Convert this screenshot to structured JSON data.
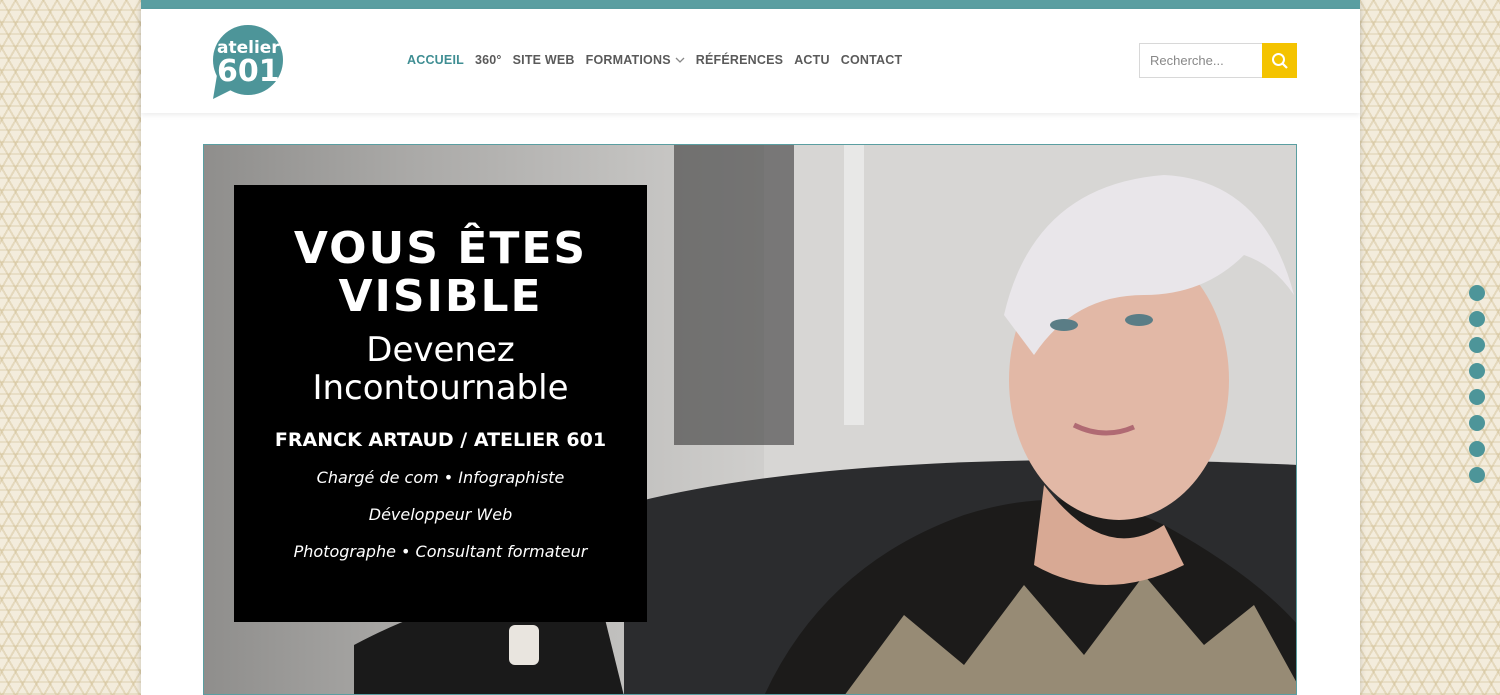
{
  "brand": {
    "logo_text_top": "atelier",
    "logo_text_bottom": "601",
    "accent": "#5a9ea1",
    "search_button": "#f4c300"
  },
  "nav": {
    "items": [
      {
        "label": "ACCUEIL",
        "active": true
      },
      {
        "label": "360°"
      },
      {
        "label": "SITE WEB"
      },
      {
        "label": "FORMATIONS",
        "icon": "chevron-down-icon"
      },
      {
        "label": "RÉFÉRENCES"
      },
      {
        "label": "ACTU"
      },
      {
        "label": "CONTACT"
      }
    ]
  },
  "search": {
    "placeholder": "Recherche...",
    "icon": "search-icon"
  },
  "hero": {
    "headline": "VOUS ÊTES VISIBLE",
    "subheadline": "Devenez Incontournable",
    "name": "FRANCK ARTAUD / ATELIER 601",
    "roles": [
      "Chargé de com • Infographiste",
      "Développeur  Web",
      "Photographe • Consultant formateur"
    ]
  },
  "slider": {
    "dot_count": 8
  }
}
